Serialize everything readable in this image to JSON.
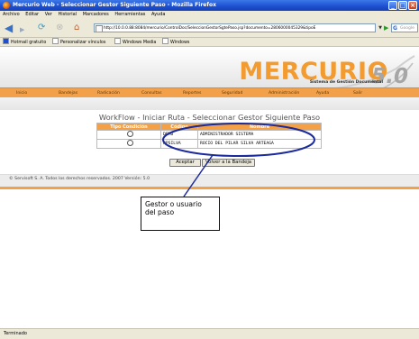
{
  "window": {
    "title": "Mercurio Web - Seleccionar Gestor Siguiente Paso - Mozilla Firefox",
    "minimize": "_",
    "maximize": "□",
    "close": "×"
  },
  "menubar": [
    "Archivo",
    "Editar",
    "Ver",
    "Historial",
    "Marcadores",
    "Herramientas",
    "Ayuda"
  ],
  "toolbar": {
    "url": "http://10.0.0.88:8084/mercurio/ControlDoc/SeleccionGestorSgtePaso.jsp?documento=2806000045329&tipoE",
    "search_placeholder": "Google",
    "back_icon": "back-arrow-icon",
    "forward_icon": "forward-arrow-icon",
    "reload_icon": "reload-icon",
    "stop_icon": "stop-icon",
    "home_icon": "home-icon"
  },
  "bookmarks": [
    "Hotmail gratuito",
    "Personalizar vínculos",
    "Windows Media",
    "Windows"
  ],
  "logo": {
    "word": "MERCURIO",
    "subtitle": "Sistema de Gestión Documental",
    "version": "5.0"
  },
  "nav": [
    "Inicio",
    "Bandejas",
    "Radicación",
    "Consultas",
    "Reportes",
    "Seguridad",
    "Administración",
    "Ayuda",
    "Salir"
  ],
  "page": {
    "title": "WorkFlow - Iniciar Ruta - Seleccionar Gestor Siguiente Paso"
  },
  "table": {
    "headers": [
      "Tipo Condición",
      "Código",
      "Nombre"
    ],
    "rows": [
      {
        "code": "DEMO",
        "name": "ADMINISTRADOR SISTEMA"
      },
      {
        "code": "RPSILVA",
        "name": "ROCIO DEL PILAR SILVA ARTEAGA"
      }
    ]
  },
  "buttons": {
    "accept": "Aceptar",
    "back_to_inbox": "Volver a la Bandeja"
  },
  "footer": {
    "copyright": "© Servisoft S. A. Todos los derechos reservados. 2007 Versión: 5.0"
  },
  "callout": {
    "line1": "Gestor o usuario",
    "line2": "del paso"
  },
  "status": "Terminado",
  "colors": {
    "accent": "#f2a14a",
    "title_bar": "#1d4fd0",
    "callout_ellipse": "#1b2a9c"
  }
}
